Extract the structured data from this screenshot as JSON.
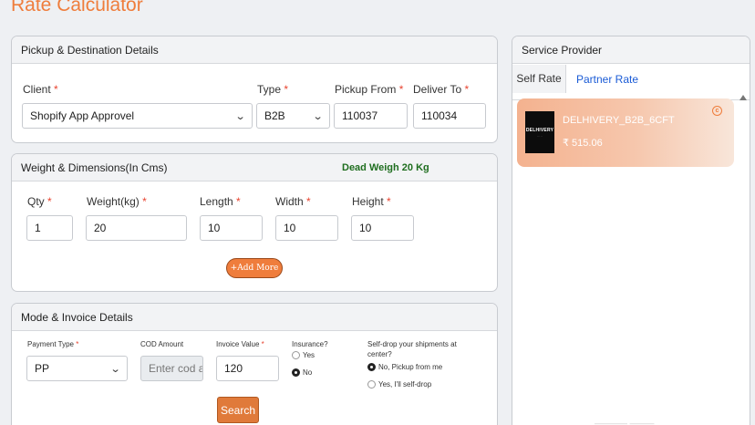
{
  "page": {
    "title": "Rate Calculator"
  },
  "pickup": {
    "header": "Pickup & Destination Details",
    "client_label": "Client",
    "client_value": "Shopify App Approvel",
    "type_label": "Type",
    "type_value": "B2B",
    "pickup_label": "Pickup From",
    "pickup_value": "110037",
    "deliver_label": "Deliver To",
    "deliver_value": "110034",
    "required_mark": "*"
  },
  "weight": {
    "header": "Weight & Dimensions(In Cms)",
    "dead_weight": "Dead Weigh 20 Kg",
    "qty_label": "Qty",
    "qty_value": "1",
    "weight_label": "Weight(kg)",
    "weight_value": "20",
    "length_label": "Length",
    "length_value": "10",
    "width_label": "Width",
    "width_value": "10",
    "height_label": "Height",
    "height_value": "10",
    "add_more": "+Add More"
  },
  "mode": {
    "header": "Mode & Invoice Details",
    "payment_label": "Payment Type",
    "payment_value": "PP",
    "cod_label": "COD Amount",
    "cod_placeholder": "Enter cod ar",
    "invoice_label": "Invoice Value",
    "invoice_value": "120",
    "insurance_label": "Insurance?",
    "insurance_yes": "Yes",
    "insurance_no": "No",
    "selfdrop_label_1": "Self-drop your shipments at",
    "selfdrop_label_2": "center?",
    "selfdrop_no": "No, Pickup from me",
    "selfdrop_yes": "Yes, I'll self-drop",
    "search": "Search"
  },
  "provider": {
    "header": "Service Provider",
    "tabs": [
      "Self Rate",
      "Partner Rate"
    ],
    "active_tab": "Self Rate",
    "card": {
      "logo_text": "DELHIVERY",
      "name": "DELHIVERY_B2B_6CFT",
      "price": "₹ 515.06"
    }
  },
  "colors": {
    "accent": "#ef7d3c",
    "link": "#1a5bd6",
    "dead_weight": "#1f6e1f",
    "required": "#e8432f"
  },
  "icons": [
    "chevron-down-icon",
    "radio-icon",
    "scroll-up-icon",
    "select-indicator-icon"
  ]
}
